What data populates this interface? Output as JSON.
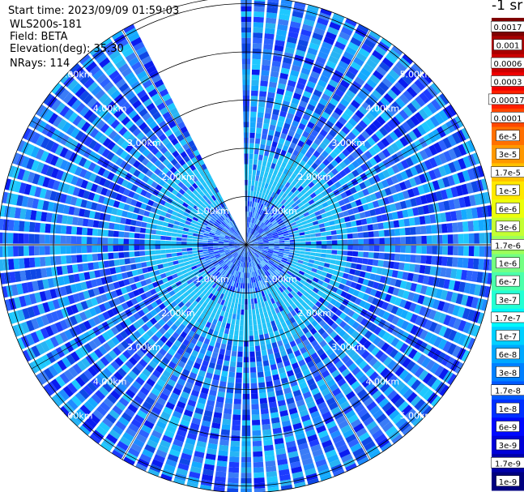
{
  "header": {
    "start_time": "Start time: 2023/09/09 01:59:03",
    "instrument": "WLS200s-181",
    "field": "Field: BETA",
    "elevation": "Elevation(deg): 35.30",
    "nrays": "NRays: 114"
  },
  "colorbar": {
    "title": "-1 sr",
    "ticks": [
      "0.0017",
      "0.001",
      "0.0006",
      "0.0003",
      "0.00017",
      "0.0001",
      "6e-5",
      "3e-5",
      "1.7e-5",
      "1e-5",
      "6e-6",
      "3e-6",
      "1.7e-6",
      "1e-6",
      "6e-7",
      "3e-7",
      "1.7e-7",
      "1e-7",
      "6e-8",
      "3e-8",
      "1.7e-8",
      "1e-8",
      "6e-9",
      "3e-9",
      "1.7e-9",
      "1e-9"
    ],
    "colors": [
      "#7f0000",
      "#a80000",
      "#cc0000",
      "#f00000",
      "#ff2000",
      "#ff4800",
      "#ff7000",
      "#ff9800",
      "#ffc000",
      "#ffe800",
      "#ecff0b",
      "#c4ff33",
      "#9cff5b",
      "#74ff83",
      "#4cffab",
      "#24ffd3",
      "#00f8ff",
      "#00d0ff",
      "#00a8ff",
      "#0080ff",
      "#0058ff",
      "#0030ff",
      "#0008ff",
      "#0000d8",
      "#0000a8",
      "#00007f"
    ]
  },
  "chart_data": {
    "type": "heatmap",
    "projection": "polar (PPI scan)",
    "field": "BETA",
    "unit": "-1 sr",
    "elevation_deg": 35.3,
    "nrays": 114,
    "range_rings_km": [
      1,
      2,
      3,
      4,
      5
    ],
    "ring_labels": [
      "1.00km",
      "2.00km",
      "3.00km",
      "4.00km",
      "5.00km"
    ],
    "missing_azimuth_sector_deg": [
      333,
      360
    ],
    "value_range": [
      "1e-9",
      "0.0017"
    ],
    "dominant_values": [
      "6e-9",
      "1e-8",
      "1.7e-8",
      "3e-8",
      "6e-8"
    ],
    "grid": true
  }
}
